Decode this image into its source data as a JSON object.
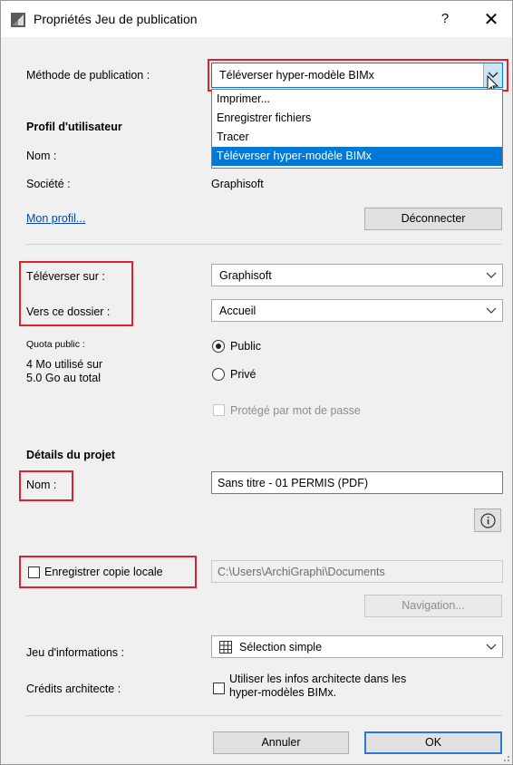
{
  "window": {
    "title": "Propriétés Jeu de publication",
    "help_label": "?",
    "close_label": "✕"
  },
  "publication": {
    "method_label": "Méthode de publication :",
    "method_value": "Téléverser hyper-modèle BIMx",
    "options": [
      "Imprimer...",
      "Enregistrer fichiers",
      "Tracer",
      "Téléverser hyper-modèle BIMx"
    ],
    "selected_index": 3
  },
  "user_profile": {
    "heading": "Profil d'utilisateur",
    "name_label": "Nom :",
    "name_value": "",
    "company_label": "Société :",
    "company_value": "Graphisoft",
    "my_profile_link": "Mon profil...",
    "disconnect_button": "Déconnecter"
  },
  "upload": {
    "upload_to_label": "Téléverser sur :",
    "upload_to_value": "Graphisoft",
    "folder_label": "Vers ce dossier :",
    "folder_value": "Accueil",
    "quota_label": "Quota public :",
    "quota_line1": "4 Mo utilisé sur",
    "quota_line2": "5.0 Go au total",
    "public_label": "Public",
    "private_label": "Privé",
    "visibility": "Public",
    "password_label": "Protégé par mot de passe",
    "password_checked": false
  },
  "project": {
    "heading": "Détails du projet",
    "name_label": "Nom :",
    "name_value": "Sans titre - 01 PERMIS (PDF)",
    "info_icon": "info-icon"
  },
  "local_copy": {
    "label": "Enregistrer copie locale",
    "checked": false,
    "path": "C:\\Users\\ArchiGraphi\\Documents",
    "browse_button": "Navigation..."
  },
  "info_set": {
    "label": "Jeu d'informations :",
    "value": "Sélection simple",
    "icon": "table-icon"
  },
  "architect": {
    "label": "Crédits architecte :",
    "checkbox_line1": "Utiliser les infos architecte dans les",
    "checkbox_line2": "hyper-modèles BIMx.",
    "checked": false
  },
  "footer": {
    "cancel_button": "Annuler",
    "ok_button": "OK"
  },
  "colors": {
    "highlight_box": "#e0202a",
    "selection": "#0078d7",
    "default_button_border": "#2b78d6"
  }
}
